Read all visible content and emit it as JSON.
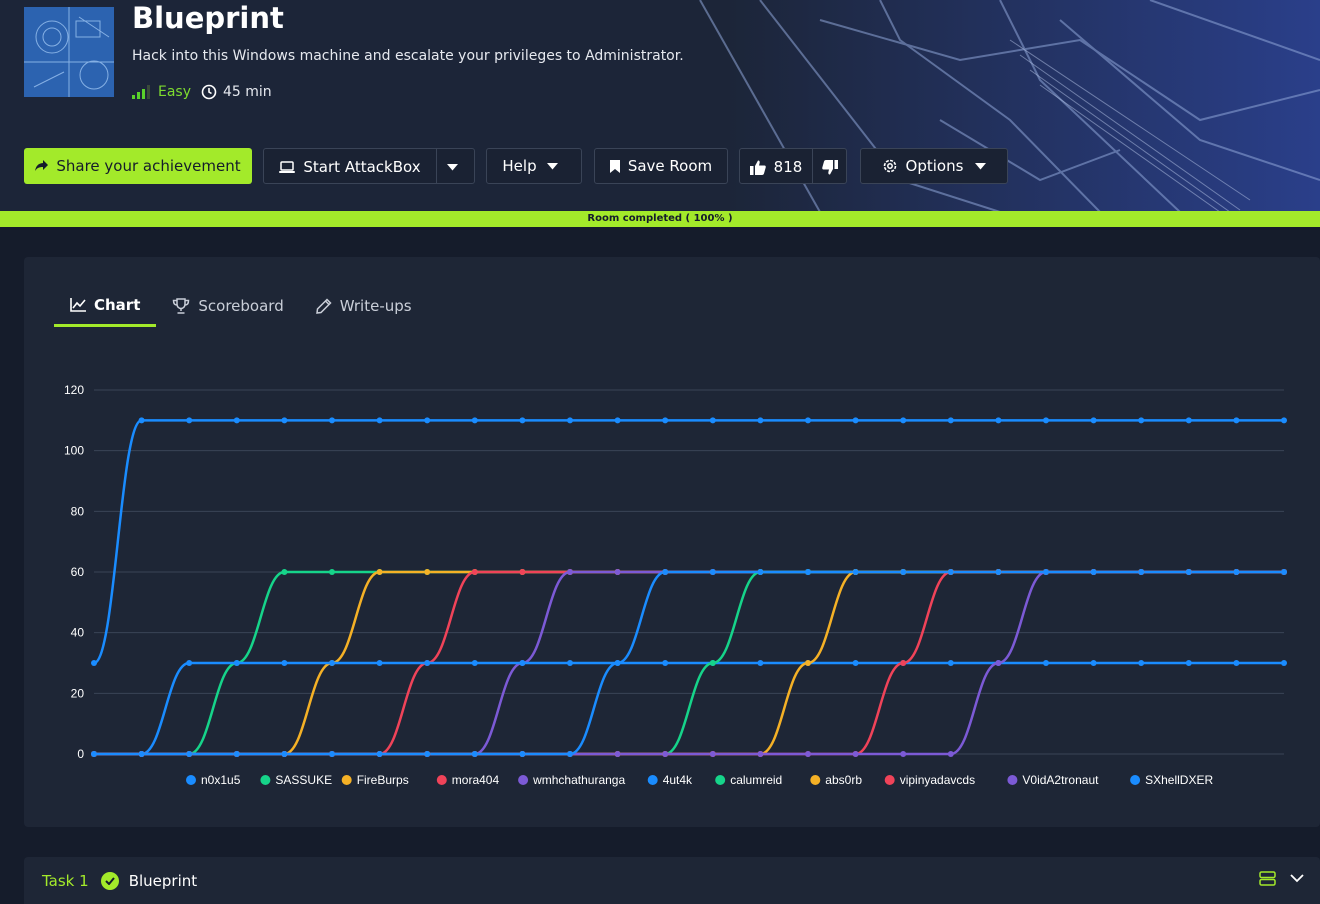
{
  "room": {
    "title": "Blueprint",
    "description": "Hack into this Windows machine and escalate your privileges to Administrator.",
    "difficulty": "Easy",
    "duration": "45 min"
  },
  "actions": {
    "share_label": "Share your achievement",
    "attackbox_label": "Start AttackBox",
    "help_label": "Help",
    "save_label": "Save Room",
    "likes": "818",
    "options_label": "Options"
  },
  "progress": {
    "label": "Room completed ( 100% )",
    "value": 100
  },
  "tabs": [
    {
      "label": "Chart",
      "icon": "chart-line-icon",
      "active": true
    },
    {
      "label": "Scoreboard",
      "icon": "trophy-icon",
      "active": false
    },
    {
      "label": "Write-ups",
      "icon": "pencil-icon",
      "active": false
    }
  ],
  "colors": {
    "accent": "#a3ea2a",
    "background": "#151c2b",
    "card": "#1e2636"
  },
  "chart_data": {
    "type": "line",
    "x": [
      0,
      1,
      2,
      3,
      4,
      5,
      6,
      7,
      8,
      9,
      10,
      11,
      12,
      13,
      14,
      15,
      16,
      17,
      18,
      19,
      20,
      21,
      22,
      23,
      24,
      25
    ],
    "ylim": [
      0,
      120
    ],
    "yticks": [
      "0",
      "20",
      "40",
      "60",
      "80",
      "100",
      "120"
    ],
    "grid": true,
    "legend": "bottom",
    "series": [
      {
        "name": "n0x1u5",
        "color": "#1a8cff",
        "values": [
          30,
          110,
          110,
          110,
          110,
          110,
          110,
          110,
          110,
          110,
          110,
          110,
          110,
          110,
          110,
          110,
          110,
          110,
          110,
          110,
          110,
          110,
          110,
          110,
          110,
          110
        ]
      },
      {
        "name": "SASSUKE",
        "color": "#16d48a",
        "values": [
          0,
          0,
          0,
          30,
          60,
          60,
          60,
          60,
          60,
          60,
          60,
          60,
          60,
          60,
          60,
          60,
          60,
          60,
          60,
          60,
          60,
          60,
          60,
          60,
          60,
          60
        ]
      },
      {
        "name": "FireBurps",
        "color": "#f5b126",
        "values": [
          0,
          0,
          0,
          0,
          0,
          30,
          60,
          60,
          60,
          60,
          60,
          60,
          60,
          60,
          60,
          60,
          60,
          60,
          60,
          60,
          60,
          60,
          60,
          60,
          60,
          60
        ]
      },
      {
        "name": "mora404",
        "color": "#f04359",
        "values": [
          0,
          0,
          0,
          0,
          0,
          0,
          0,
          30,
          60,
          60,
          60,
          60,
          60,
          60,
          60,
          60,
          60,
          60,
          60,
          60,
          60,
          60,
          60,
          60,
          60,
          60
        ]
      },
      {
        "name": "wmhchathuranga",
        "color": "#7c5ad6",
        "values": [
          0,
          0,
          0,
          0,
          0,
          0,
          0,
          0,
          0,
          30,
          60,
          60,
          60,
          60,
          60,
          60,
          60,
          60,
          60,
          60,
          60,
          60,
          60,
          60,
          60,
          60
        ]
      },
      {
        "name": "4ut4k",
        "color": "#1a8cff",
        "values": [
          0,
          0,
          30,
          30,
          30,
          30,
          30,
          30,
          30,
          30,
          30,
          30,
          30,
          30,
          30,
          30,
          30,
          30,
          30,
          30,
          30,
          30,
          30,
          30,
          30,
          30
        ]
      },
      {
        "name": "calumreid",
        "color": "#16d48a",
        "values": [
          0,
          0,
          0,
          0,
          0,
          0,
          0,
          0,
          0,
          0,
          0,
          0,
          0,
          30,
          60,
          60,
          60,
          60,
          60,
          60,
          60,
          60,
          60,
          60,
          60,
          60
        ]
      },
      {
        "name": "abs0rb",
        "color": "#f5b126",
        "values": [
          0,
          0,
          0,
          0,
          0,
          0,
          0,
          0,
          0,
          0,
          0,
          0,
          0,
          0,
          0,
          30,
          60,
          60,
          60,
          60,
          60,
          60,
          60,
          60,
          60,
          60
        ]
      },
      {
        "name": "vipinyadavcds",
        "color": "#f04359",
        "values": [
          0,
          0,
          0,
          0,
          0,
          0,
          0,
          0,
          0,
          0,
          0,
          0,
          0,
          0,
          0,
          0,
          0,
          30,
          60,
          60,
          60,
          60,
          60,
          60,
          60,
          60
        ]
      },
      {
        "name": "V0idA2tronaut",
        "color": "#7c5ad6",
        "values": [
          0,
          0,
          0,
          0,
          0,
          0,
          0,
          0,
          0,
          0,
          0,
          0,
          0,
          0,
          0,
          0,
          0,
          0,
          0,
          30,
          60,
          60,
          60,
          60,
          60,
          60
        ]
      },
      {
        "name": "SXhellDXER",
        "color": "#1a8cff",
        "values": [
          0,
          0,
          0,
          0,
          0,
          0,
          0,
          0,
          0,
          0,
          0,
          30,
          60,
          60,
          60,
          60,
          60,
          60,
          60,
          60,
          60,
          60,
          60,
          60,
          60,
          60
        ]
      }
    ]
  },
  "task": {
    "number": "Task 1",
    "title": "Blueprint"
  }
}
